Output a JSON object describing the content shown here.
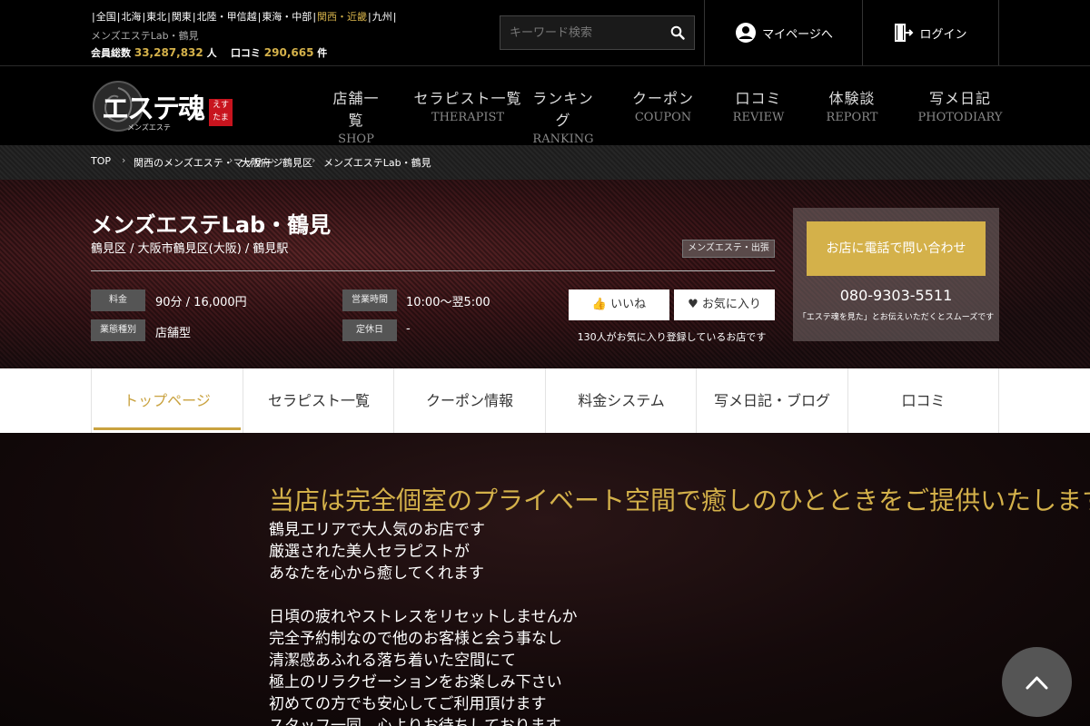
{
  "topbar": {
    "area_links": [
      "全国",
      "北海",
      "東北",
      "関東",
      "北陸・甲信越",
      "東海・中部",
      "関西・近畿",
      "九州"
    ],
    "active_area_index": 6,
    "shop_sub": "メンズエステLab・鶴見",
    "members_label": "会員総数",
    "members_count": "33,287,832",
    "members_unit": "人",
    "reviews_label": "口コミ",
    "reviews_count": "290,665",
    "reviews_unit": "件",
    "search_placeholder": "キーワード検索",
    "mypage_label": "マイページへ",
    "login_label": "ログイン"
  },
  "logo": {
    "text": "エステ魂",
    "badge": "えすたま",
    "sub": "メンズエステ"
  },
  "nav": [
    {
      "jp": "店舗一覧",
      "en": "SHOP"
    },
    {
      "jp": "セラピスト一覧",
      "en": "THERAPIST"
    },
    {
      "jp": "ランキング",
      "en": "RANKING"
    },
    {
      "jp": "クーポン",
      "en": "COUPON"
    },
    {
      "jp": "口コミ",
      "en": "REVIEW"
    },
    {
      "jp": "体験談",
      "en": "REPORT"
    },
    {
      "jp": "写メ日記",
      "en": "PHOTODIARY"
    }
  ],
  "breadcrumb": [
    "TOP",
    "関西のメンズエステ・マッサージ",
    "大阪府",
    "鶴見区",
    "メンズエステLab・鶴見"
  ],
  "shop": {
    "title": "メンズエステLab・鶴見",
    "location": "鶴見区 / 大阪市鶴見区(大阪) / 鶴見駅",
    "tag": "メンズエステ・出張",
    "price_label": "料金",
    "price_value": "90分 / 16,000円",
    "hours_label": "営業時間",
    "hours_value": "10:00〜翌5:00",
    "type_label": "業態種別",
    "type_value": "店舗型",
    "holiday_label": "定休日",
    "holiday_value": "-",
    "like_label": "いいね",
    "fav_label": "お気に入り",
    "note": "130人がお気に入り登録しているお店です",
    "contact_button": "お店に電話で問い合わせ",
    "tel": "080-9303-5511",
    "contact_note": "「エステ魂を見た」とお伝えいただくとスムーズです"
  },
  "tabs": [
    "トップページ",
    "セラピスト一覧",
    "クーポン情報",
    "料金システム",
    "写メ日記・ブログ",
    "口コミ"
  ],
  "active_tab_index": 0,
  "content": {
    "title": "当店は完全個室のプライベート空間で癒しのひとときをご提供いたします",
    "lines": [
      "鶴見エリアで大人気のお店です",
      "厳選された美人セラピストが",
      "あなたを心から癒してくれます",
      "",
      "日頃の疲れやストレスをリセットしませんか",
      "完全予約制なので他のお客様と会う事なし",
      "清潔感あふれる落ち着いた空間にて",
      "極上のリラクゼーションをお楽しみ下さい",
      "初めての方でも安心してご利用頂けます",
      "スタッフ一同、心よりお待ちしております"
    ]
  }
}
